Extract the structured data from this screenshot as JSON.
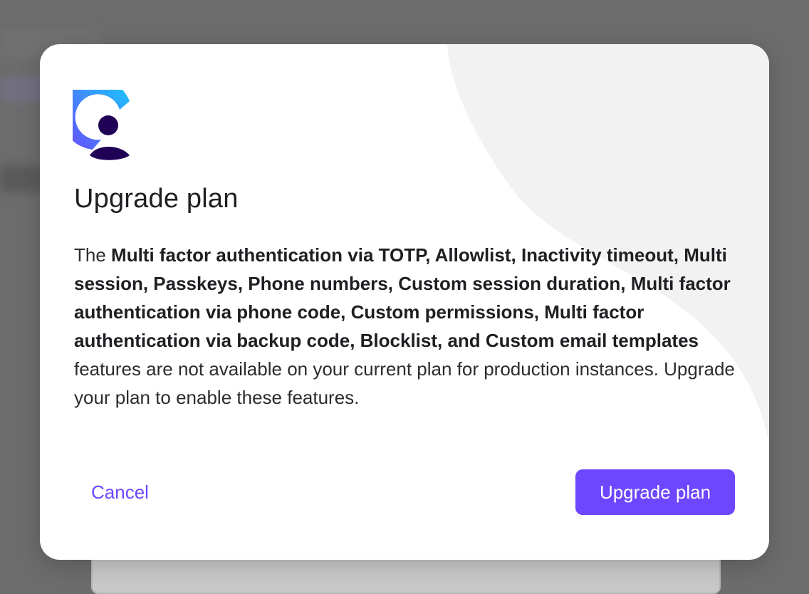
{
  "dialog": {
    "title": "Upgrade plan",
    "body": {
      "prefix": "The ",
      "features": "Multi factor authentication via TOTP, Allowlist, Inactivity timeout, Multi session, Passkeys, Phone numbers, Custom session duration, Multi factor authentication via phone code, Custom permissions, Multi factor authentication via backup code, Blocklist, and Custom email templates",
      "suffix": " features are not available on your current plan for production instances. Upgrade your plan to enable these features."
    },
    "cancel_label": "Cancel",
    "upgrade_label": "Upgrade plan"
  },
  "colors": {
    "accent": "#6c47ff",
    "overlay": "#6c6c6c",
    "logo_gradient_start": "#6c47ff",
    "logo_gradient_end": "#17ccfc",
    "logo_dark": "#1f0256"
  },
  "icons": {
    "logo": "clerk-logo-icon"
  }
}
